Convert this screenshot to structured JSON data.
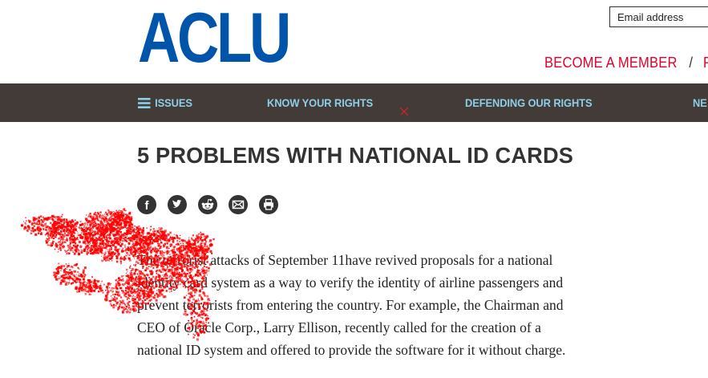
{
  "header": {
    "logo_text": "ACLU",
    "email_placeholder": "Email address",
    "become_member": "BECOME A MEMBER",
    "separator": "/",
    "next_link_fragment": "R"
  },
  "nav": {
    "issues": "ISSUES",
    "know_your_rights": "KNOW YOUR RIGHTS",
    "defending_our_rights": "DEFENDING OUR RIGHTS",
    "next_fragment": "NE"
  },
  "article": {
    "title": "5 PROBLEMS WITH NATIONAL ID CARDS",
    "share_icons": [
      "facebook-icon",
      "twitter-icon",
      "reddit-icon",
      "email-icon",
      "print-icon"
    ],
    "lines": [
      "The terrorist attacks of September 11have revived proposals for a national",
      "identity card system as a way to verify the identity of airline passengers and",
      "prevent terrorists from entering the country. For example, the Chairman and",
      "CEO of Oracle Corp., Larry Ellison, recently called for the creation of a",
      "national ID system and offered to provide the software for it without charge."
    ]
  },
  "colors": {
    "brand_blue": "#0055aa",
    "link_red": "#e4002b",
    "nav_bg": "#433b38",
    "nav_text": "#8ecde8",
    "title": "#333333",
    "scribble": "#ff0000"
  }
}
